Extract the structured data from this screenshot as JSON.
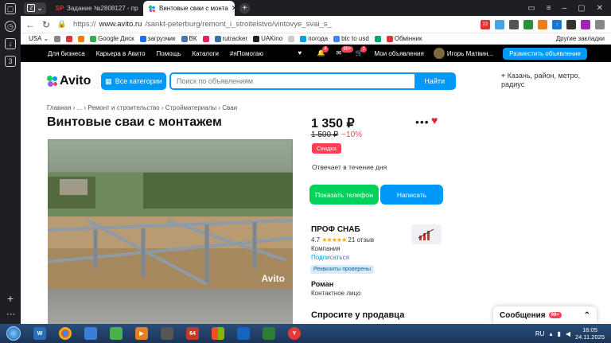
{
  "browser": {
    "tab_count": "2",
    "tabs": [
      {
        "label": "Задание №2808127 - про",
        "icon": "sp-favicon"
      },
      {
        "label": "Винтовые сваи с монта",
        "icon": "avito-favicon"
      }
    ],
    "url_scheme": "https://",
    "url_host": "www.avito.ru",
    "url_path": "/sankt-peterburg/remont_i_stroitelstvo/vintovye_svai_s_",
    "bookmarks": [
      "USA",
      "Google Диск",
      "загрузчик",
      "ВК",
      "rutracker",
      "UAKino",
      "погода",
      "btc to usd",
      "Обмінник"
    ],
    "other_bookmarks": "Другие закладки",
    "rail_badge": "3"
  },
  "topbar": {
    "links": [
      "Для бизнеса",
      "Карьера в Авито",
      "Помощь",
      "Каталоги",
      "#яПомогаю"
    ],
    "notif_badges": [
      "4",
      "99+",
      "1"
    ],
    "my_ads": "Мои объявления",
    "user": "Игорь Матвин...",
    "place_ad": "Разместить объявление"
  },
  "header": {
    "logo": "Avito",
    "categories": "Все категории",
    "search_placeholder": "Поиск по объявлениям",
    "search_button": "Найти",
    "location": "Казань, район, метро, радиус"
  },
  "listing": {
    "breadcrumb": "Главная › ... › Ремонт и строительство › Стройматериалы › Сваи",
    "title": "Винтовые сваи с монтажем",
    "watermark": "Avito",
    "price": "1 350 ₽",
    "old_price": "1 500 ₽",
    "discount": "−10%",
    "sale_badge": "Скидка",
    "response_time": "Отвечает в течение дня",
    "show_phone": "Показать телефон",
    "write": "Написать",
    "seller_name": "ПРОФ СНАБ",
    "rating": "4.7",
    "stars": "★★★★★",
    "reviews": "21 отзыв",
    "seller_type": "Компания",
    "subscribe": "Подписаться",
    "verified": "Реквизиты проверены",
    "contact_name": "Роман",
    "contact_role": "Контактное лицо",
    "ask_seller": "Спросите у продавца"
  },
  "messages": {
    "label": "Сообщения",
    "count": "99+"
  },
  "taskbar": {
    "lang": "RU",
    "time": "16:05",
    "date": "24.11.2025"
  },
  "colors": {
    "avito_blue": "#0099f7",
    "avito_green": "#02d15c",
    "avito_red": "#ff4053"
  }
}
